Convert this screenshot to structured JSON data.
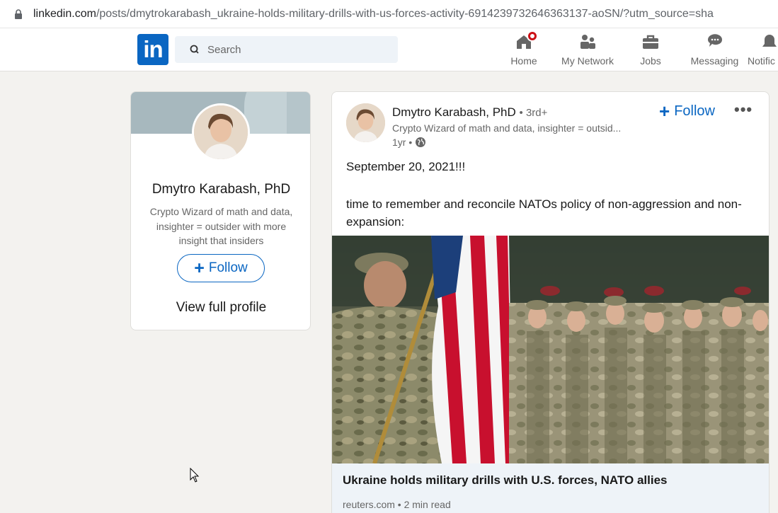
{
  "browser": {
    "url_host": "linkedin.com",
    "url_path": "/posts/dmytrokarabash_ukraine-holds-military-drills-with-us-forces-activity-6914239732646363137-aoSN/?utm_source=sha"
  },
  "nav": {
    "logo_text": "in",
    "search_placeholder": "Search",
    "items": [
      {
        "label": "Home",
        "icon": "home-icon",
        "has_badge": true
      },
      {
        "label": "My Network",
        "icon": "network-icon"
      },
      {
        "label": "Jobs",
        "icon": "briefcase-icon"
      },
      {
        "label": "Messaging",
        "icon": "messaging-icon"
      },
      {
        "label": "Notific",
        "icon": "bell-icon"
      }
    ]
  },
  "profile": {
    "name": "Dmytro Karabash, PhD",
    "headline": "Crypto Wizard of math and data, insighter = outsider with more insight that insiders",
    "follow_label": "Follow",
    "view_profile_label": "View full profile"
  },
  "post": {
    "author": "Dmytro Karabash, PhD",
    "degree": "• 3rd+",
    "subheadline": "Crypto Wizard of math and data, insighter = outsid...",
    "time": "1yr •",
    "follow_label": "Follow",
    "more_label": "•••",
    "date_text": "September 20, 2021!!!",
    "body_text": "time to remember and reconcile NATOs policy of non-aggression and non-expansion:",
    "article": {
      "title": "Ukraine holds military drills with U.S. forces, NATO allies",
      "source": "reuters.com • 2 min read"
    }
  },
  "colors": {
    "brand": "#0a66c2",
    "badge": "#cc1016",
    "page_bg": "#f3f2ef"
  }
}
